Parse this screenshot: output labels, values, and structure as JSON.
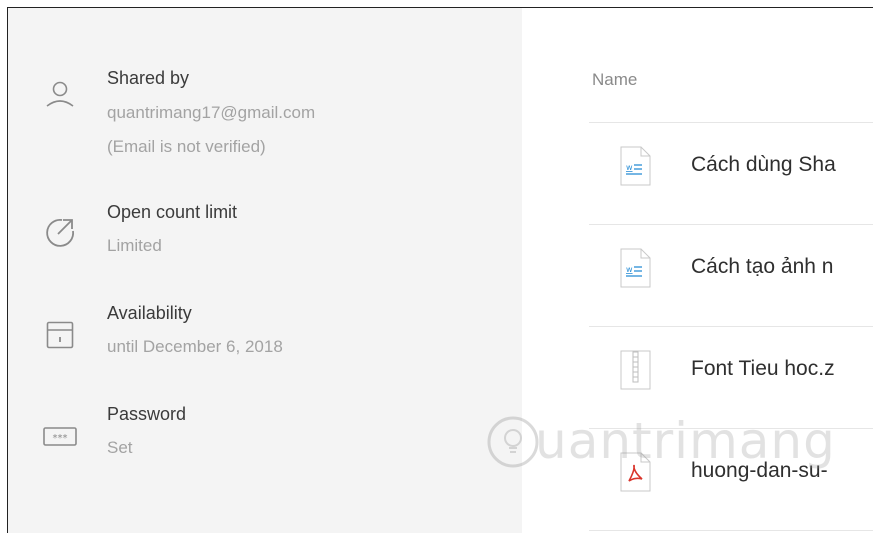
{
  "shared_info": {
    "shared_by": {
      "title": "Shared by",
      "email": "quantrimang17@gmail.com",
      "note": "(Email is not verified)",
      "icon": "user-icon"
    },
    "open_count": {
      "title": "Open count limit",
      "value": "Limited",
      "icon": "external-link-icon"
    },
    "availability": {
      "title": "Availability",
      "value": "until December 6, 2018",
      "icon": "calendar-icon"
    },
    "password": {
      "title": "Password",
      "value": "Set",
      "icon": "password-icon"
    }
  },
  "file_list": {
    "column_header": "Name",
    "files": [
      {
        "name": "Cách dùng Sha",
        "type": "word-doc-icon"
      },
      {
        "name": "Cách tạo ảnh n",
        "type": "word-doc-icon"
      },
      {
        "name": "Font Tieu hoc.z",
        "type": "zip-file-icon"
      },
      {
        "name": "huong-dan-su-",
        "type": "pdf-file-icon"
      }
    ]
  },
  "watermark": {
    "text": "uantrimang"
  },
  "colors": {
    "panel_bg": "#f4f4f4",
    "word_blue": "#2b8fd6",
    "pdf_red": "#d9342b"
  }
}
